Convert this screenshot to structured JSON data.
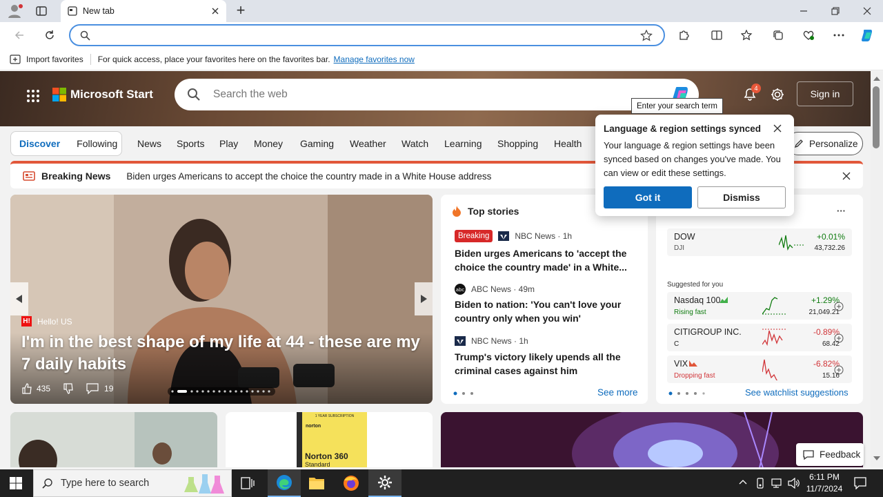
{
  "browser": {
    "tab_title": "New tab",
    "new_tab": "+",
    "favorites_bar": {
      "import_label": "Import favorites",
      "message": "For quick access, place your favorites here on the favorites bar.",
      "manage_link": "Manage favorites now"
    }
  },
  "page": {
    "brand": "Microsoft Start",
    "search_placeholder": "Search the web",
    "notification_count": "4",
    "sign_in": "Sign in",
    "tooltip": "Enter your search term",
    "nav": {
      "discover": "Discover",
      "following": "Following",
      "items": [
        "News",
        "Sports",
        "Play",
        "Money",
        "Gaming",
        "Weather",
        "Watch",
        "Learning",
        "Shopping",
        "Health"
      ],
      "personalize": "Personalize"
    },
    "breaking": {
      "label": "Breaking News",
      "headline": "Biden urges Americans to accept the choice the country made in a White House address"
    },
    "hero": {
      "source": "Hello! US",
      "headline": "I'm in the best shape of my life at 44 - these are my 7 daily habits",
      "likes": "435",
      "comments": "19"
    },
    "top_stories": {
      "title": "Top stories",
      "see_more": "See more",
      "items": [
        {
          "badge": "Breaking",
          "source": "NBC News · 1h",
          "headline": "Biden urges Americans to 'accept the choice the country made' in a White..."
        },
        {
          "badge": "",
          "source": "ABC News · 49m",
          "headline": "Biden to nation: 'You can't love your country only when you win'"
        },
        {
          "badge": "",
          "source": "NBC News · 1h",
          "headline": "Trump's victory likely upends all the criminal cases against him"
        }
      ]
    },
    "watchlist": {
      "more": "···",
      "dow": {
        "name": "DOW",
        "sub": "DJI",
        "change": "+0.01%",
        "price": "43,732.26"
      },
      "suggested_label": "Suggested for you",
      "suggestions": [
        {
          "name": "Nasdaq 100",
          "sub": "Rising fast",
          "change": "+1.29%",
          "price": "21,049.21"
        },
        {
          "name": "CITIGROUP INC.",
          "sub": "C",
          "change": "-0.89%",
          "price": "68.42"
        },
        {
          "name": "VIX",
          "sub": "Dropping fast",
          "change": "-6.82%",
          "price": "15.16"
        }
      ],
      "see_link": "See watchlist suggestions"
    },
    "popup": {
      "title": "Language & region settings synced",
      "body": "Your language & region settings have been synced based on changes you've made. You can view or edit these settings.",
      "got_it": "Got it",
      "dismiss": "Dismiss"
    },
    "feedback": "Feedback",
    "ad_card": {
      "tag": "1 YEAR SUBSCRIPTION",
      "brand": "norton",
      "product": "Norton 360",
      "sub": "Standard"
    }
  },
  "taskbar": {
    "search_placeholder": "Type here to search",
    "time": "6:11 PM",
    "date": "11/7/2024"
  },
  "colors": {
    "accent": "#0f6cbd",
    "breaking_red": "#e1573a",
    "positive": "#107c10",
    "negative": "#d13438"
  }
}
